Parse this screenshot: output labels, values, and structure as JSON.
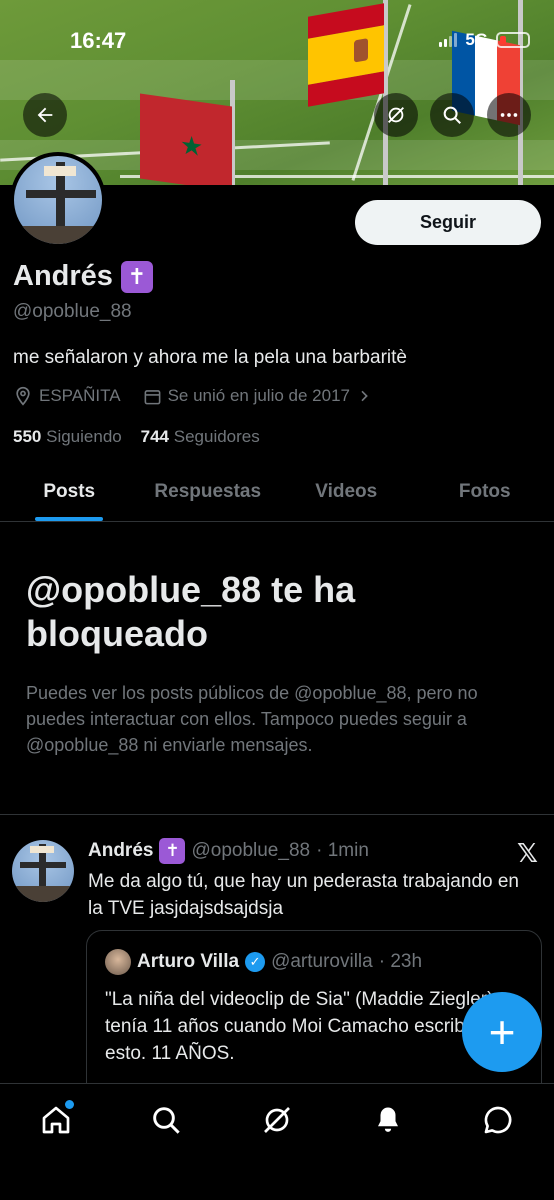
{
  "status_bar": {
    "time": "16:47",
    "network": "5G"
  },
  "header": {
    "back_icon": "arrow-left-icon",
    "grok_icon": "grok-icon",
    "search_icon": "search-icon",
    "more_icon": "more-horizontal-icon"
  },
  "profile": {
    "display_name": "Andrés",
    "badge_emoji": "✝",
    "handle": "@opoblue_88",
    "follow_label": "Seguir",
    "bio": "me señalaron y ahora me la pela una barbaritè",
    "location": "ESPAÑITA",
    "joined": "Se unió en julio de 2017",
    "following_count": "550",
    "following_label": "Siguiendo",
    "followers_count": "744",
    "followers_label": "Seguidores"
  },
  "tabs": [
    "Posts",
    "Respuestas",
    "Videos",
    "Fotos"
  ],
  "blocked": {
    "title": "@opoblue_88 te ha bloqueado",
    "text": "Puedes ver los posts públicos de @opoblue_88, pero no puedes interactuar con ellos. Tampoco puedes seguir a @opoblue_88 ni enviarle mensajes."
  },
  "post": {
    "name": "Andrés",
    "badge": "✝",
    "handle": "@opoblue_88",
    "time": "· 1min",
    "text": "Me da algo tú, que hay un pederasta trabajando en la TVE jasjdajsdsajdsja",
    "quote": {
      "name": "Arturo Villa",
      "handle": "@arturovilla",
      "time": "· 23h",
      "text": "\"La niña del videoclip de Sia\" (Maddie Ziegler) tenía 11 años cuando Moi Camacho escribió esto. 11 AÑOS."
    }
  },
  "fab_label": "+",
  "colors": {
    "accent": "#1d9bf0",
    "badge": "#9b59d6",
    "muted": "#71767b"
  }
}
